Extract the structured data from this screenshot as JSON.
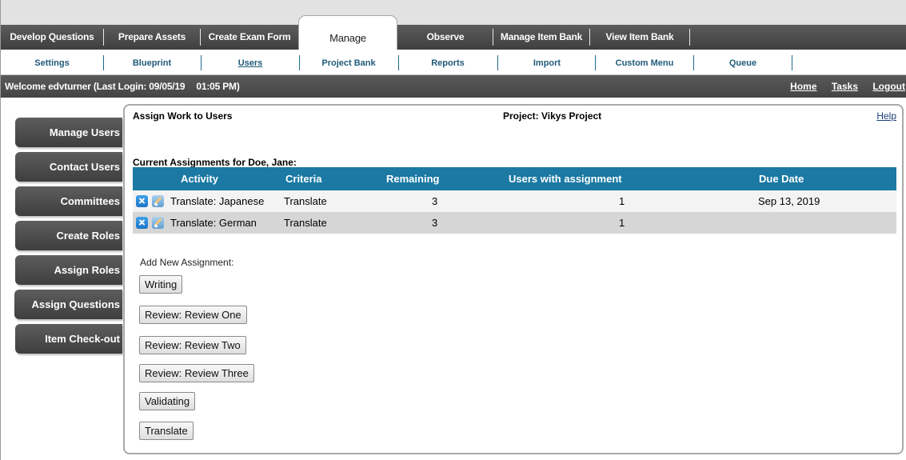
{
  "main_nav": {
    "tabs": [
      {
        "label": "Develop Questions"
      },
      {
        "label": "Prepare Assets"
      },
      {
        "label": "Create Exam Form"
      },
      {
        "label": "Manage",
        "active": true
      },
      {
        "label": "Observe"
      },
      {
        "label": "Manage Item Bank"
      },
      {
        "label": "View Item Bank"
      }
    ]
  },
  "sub_nav": {
    "tabs": [
      {
        "label": "Settings"
      },
      {
        "label": "Blueprint"
      },
      {
        "label": "Users",
        "current": true
      },
      {
        "label": "Project Bank"
      },
      {
        "label": "Reports"
      },
      {
        "label": "Import"
      },
      {
        "label": "Custom Menu"
      },
      {
        "label": "Queue"
      }
    ]
  },
  "welcome": {
    "text": "Welcome edvturner (Last Login: 09/05/19",
    "time": "01:05 PM)",
    "links": {
      "home": "Home",
      "tasks": "Tasks",
      "logout": "Logout"
    }
  },
  "side_menu": {
    "items": [
      {
        "label": "Manage Users"
      },
      {
        "label": "Contact Users"
      },
      {
        "label": "Committees"
      },
      {
        "label": "Create Roles"
      },
      {
        "label": "Assign Roles"
      },
      {
        "label": "Assign Questions"
      },
      {
        "label": "Item Check-out"
      }
    ]
  },
  "panel": {
    "title": "Assign Work to Users",
    "project": "Project: Vikys Project",
    "help": "Help",
    "assignments_heading": "Current Assignments for Doe, Jane:",
    "columns": {
      "activity": "Activity",
      "criteria": "Criteria",
      "remaining": "Remaining",
      "users": "Users with assignment",
      "due": "Due Date"
    },
    "rows": [
      {
        "activity": "Translate: Japanese",
        "criteria": "Translate",
        "remaining": "3",
        "users": "1",
        "due": "Sep 13, 2019"
      },
      {
        "activity": "Translate: German",
        "criteria": "Translate",
        "remaining": "3",
        "users": "1",
        "due": ""
      }
    ],
    "add_label": "Add New Assignment:",
    "add_buttons": [
      {
        "label": "Writing"
      },
      {
        "label": "Review: Review One"
      },
      {
        "label": "Review: Review Two"
      },
      {
        "label": "Review: Review Three"
      },
      {
        "label": "Validating"
      },
      {
        "label": "Translate"
      }
    ]
  },
  "colors": {
    "nav_dark": "#4a4a4a",
    "table_header": "#1b79a3",
    "link": "#1f5a7a"
  },
  "icons": {
    "remove": "close-icon",
    "edit": "edit-pencil-icon"
  }
}
